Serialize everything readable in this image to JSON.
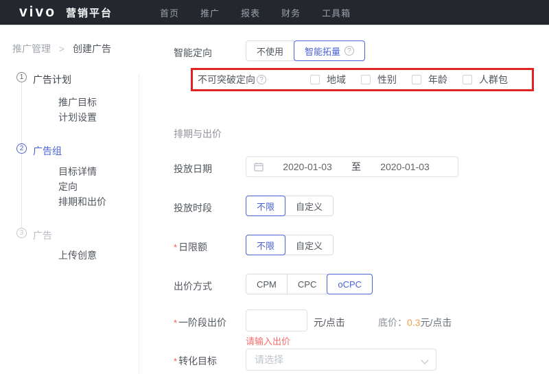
{
  "header": {
    "logo": "vivo",
    "platform_name": "营销平台",
    "nav": {
      "home": "首页",
      "promotion": "推广",
      "report": "报表",
      "finance": "财务",
      "toolbox": "工具箱"
    }
  },
  "breadcrumb": {
    "parent": "推广管理",
    "separator": ">",
    "current": "创建广告"
  },
  "steps": {
    "s1": {
      "num": "1",
      "title": "广告计划",
      "sub1": "推广目标",
      "sub2": "计划设置"
    },
    "s2": {
      "num": "2",
      "title": "广告组",
      "sub1": "目标详情",
      "sub2": "定向",
      "sub3": "排期和出价"
    },
    "s3": {
      "num": "3",
      "title": "广告",
      "sub1": "上传创意"
    }
  },
  "smart_targeting": {
    "label": "智能定向",
    "option_off": "不使用",
    "option_on": "智能拓量",
    "help_icon": "?"
  },
  "strict_targeting": {
    "label": "不可突破定向",
    "help_icon": "?",
    "cb_region": "地域",
    "cb_gender": "性别",
    "cb_age": "年龄",
    "cb_crowd": "人群包"
  },
  "schedule": {
    "section_title": "排期与出价",
    "required_mark": "*",
    "date_label": "投放日期",
    "date_start": "2020-01-03",
    "date_to": "至",
    "date_end": "2020-01-03",
    "time_label": "投放时段",
    "time_opt_unlimited": "不限",
    "time_opt_custom": "自定义",
    "limit_label": "日限额",
    "limit_opt_unlimited": "不限",
    "limit_opt_custom": "自定义",
    "bid_label": "出价方式",
    "bid_opt_cpm": "CPM",
    "bid_opt_cpc": "CPC",
    "bid_opt_ocpc": "oCPC",
    "stage_label": "一阶段出价",
    "stage_unit": "元/点击",
    "floor_label": "底价：",
    "floor_value": "0.3",
    "floor_unit": "元/点击",
    "stage_error": "请输入出价",
    "goal_label": "转化目标",
    "goal_placeholder": "请选择"
  },
  "colors": {
    "accent_blue": "#4a62d6",
    "highlight_box_red": "#e02424",
    "error_red": "#f56c6c",
    "floor_orange": "#f0a04a",
    "topbar_dark": "#24282e"
  }
}
